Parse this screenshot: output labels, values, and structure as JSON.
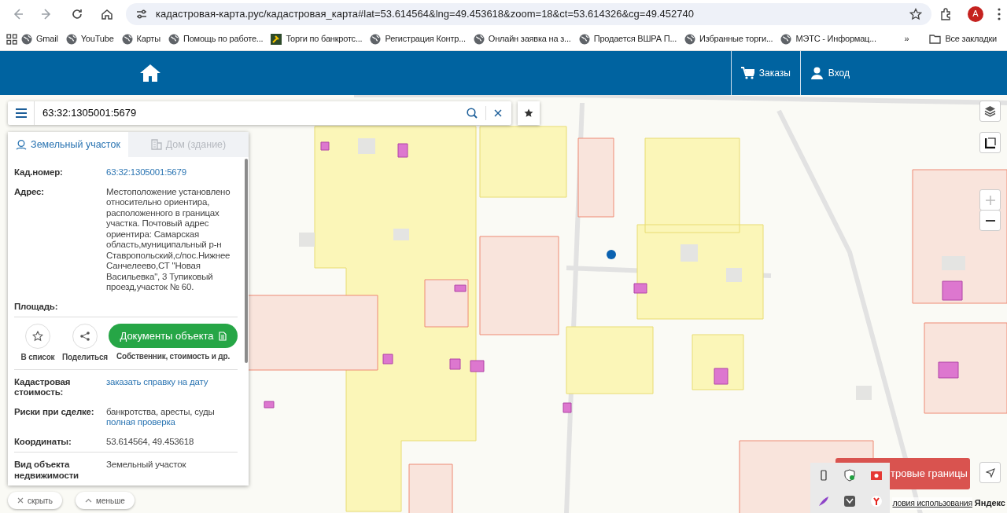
{
  "browser": {
    "url": "кадастровая-карта.рус/кадастровая_карта#lat=53.614564&lng=49.453618&zoom=18&ct=53.614326&cg=49.452740",
    "profile_initial": "A",
    "bookmarks": [
      {
        "label": "Gmail"
      },
      {
        "label": "YouTube"
      },
      {
        "label": "Карты"
      },
      {
        "label": "Помощь по работе..."
      },
      {
        "label": "Торги по банкротс..."
      },
      {
        "label": "Регистрация Контр..."
      },
      {
        "label": "Онлайн заявка на з..."
      },
      {
        "label": "Продается ВШРА П..."
      },
      {
        "label": "Избранные торги..."
      },
      {
        "label": "МЭТС - Информац..."
      }
    ],
    "more": "»",
    "all_bookmarks": "Все закладки"
  },
  "header": {
    "nav": [
      {
        "label": "Заказы",
        "kind": "cart"
      },
      {
        "label": "Вход",
        "kind": "user"
      }
    ]
  },
  "search": {
    "value": "63:32:1305001:5679"
  },
  "panel": {
    "tabs": [
      {
        "label": "Земельный участок",
        "selected": true,
        "kind": "land"
      },
      {
        "label": "Дом (здание)",
        "selected": false,
        "kind": "house"
      }
    ],
    "fields_top": [
      {
        "label": "Кад.номер:",
        "value_link": "63:32:1305001:5679"
      },
      {
        "label": "Адрес:",
        "value": "Местоположение установлено относительно ориентира, расположенного в границах участка. Почтовый адрес ориентира: Самарская область,муниципальный р-н Ставропольский,с/пос.Нижнее Санчелеево,СТ \"Новая Васильевка\", 3 Тупиковый проезд,участок № 60."
      },
      {
        "label": "Площадь:"
      }
    ],
    "actions": [
      {
        "label": "В список",
        "kind": "star"
      },
      {
        "label": "Поделиться",
        "kind": "share"
      }
    ],
    "documents": {
      "label": "Документы объекта",
      "caption": "Собственник, стоимость и др."
    },
    "fields_middle": [
      {
        "label": "Кадастровая стоимость:",
        "link": "заказать справку на дату"
      },
      {
        "label": "Риски при сделке:",
        "value": "банкротства, аресты, суды",
        "link": "полная проверка"
      },
      {
        "label": "Координаты:",
        "value": "53.614564, 49.453618"
      }
    ],
    "fields_bottom": [
      {
        "label": "Вид объекта недвижимости",
        "value": "Земельный участок"
      }
    ],
    "hide": "скрыть",
    "less": "меньше"
  },
  "map": {
    "boundaries_button": "тровые границы",
    "terms_link": "ловия использования",
    "brand": "Яндекс"
  },
  "tray": [
    {
      "kind": "usb"
    },
    {
      "kind": "shield"
    },
    {
      "kind": "red-app"
    },
    {
      "kind": "feather"
    },
    {
      "kind": "grey-app"
    },
    {
      "kind": "y-browser"
    }
  ]
}
